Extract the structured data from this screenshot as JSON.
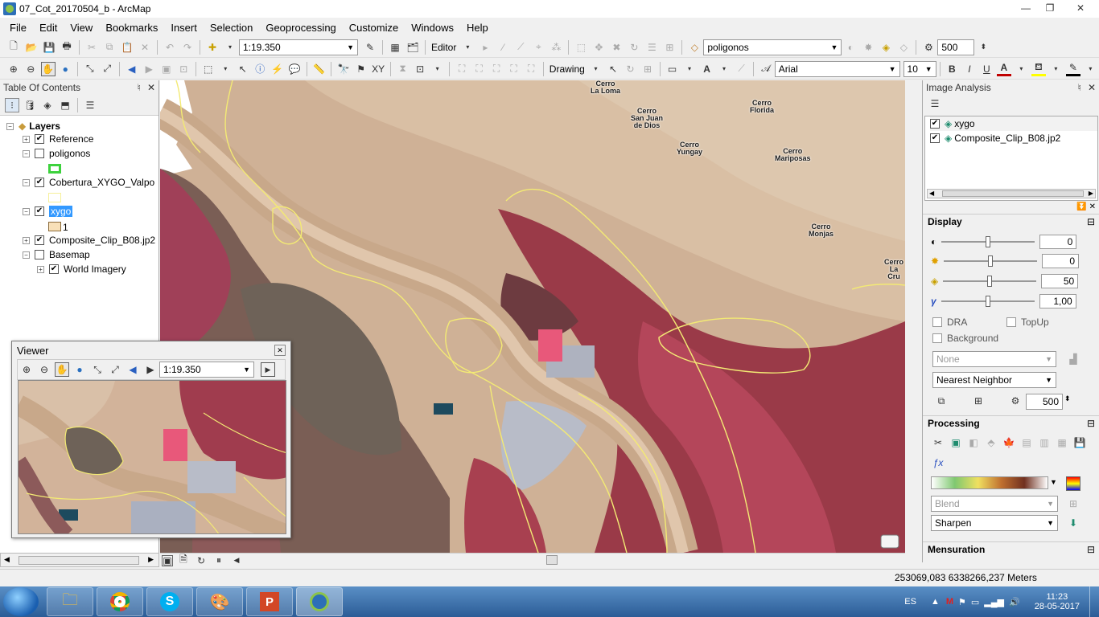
{
  "window": {
    "title": "07_Cot_20170504_b - ArcMap",
    "min": "—",
    "max": "❐",
    "close": "✕"
  },
  "menu": [
    "File",
    "Edit",
    "View",
    "Bookmarks",
    "Insert",
    "Selection",
    "Geoprocessing",
    "Customize",
    "Windows",
    "Help"
  ],
  "toolbar": {
    "scale": "1:19.350",
    "editor_label": "Editor",
    "layer_combo": "poligonos",
    "number_500": "500",
    "drawing_label": "Drawing",
    "font_name": "Arial",
    "font_size": "10",
    "bold": "B",
    "italic": "I",
    "underline": "U",
    "text_a": "A"
  },
  "toc": {
    "title": "Table Of Contents",
    "pin": "♮",
    "close": "✕",
    "layers_label": "Layers",
    "items": [
      {
        "label": "Reference",
        "checked": true
      },
      {
        "label": "poligonos",
        "checked": false
      },
      {
        "label": "Cobertura_XYGO_Valpo",
        "checked": true
      },
      {
        "label": "xygo",
        "checked": true
      },
      {
        "label": "Composite_Clip_B08.jp2",
        "checked": true
      },
      {
        "label": "Basemap",
        "checked": false
      },
      {
        "label": "World Imagery",
        "checked": true
      }
    ],
    "xygo_value": "1"
  },
  "map_labels": [
    {
      "text": "Cerro\nLa Loma"
    },
    {
      "text": "Cerro\nSan Juan\nde Dios"
    },
    {
      "text": "Cerro\nYungay"
    },
    {
      "text": "Cerro\nFlorida"
    },
    {
      "text": "Cerro\nMariposas"
    },
    {
      "text": "Cerro\nMonjas"
    },
    {
      "text": "Cerro\nLa Cru"
    }
  ],
  "viewer": {
    "title": "Viewer",
    "scale": "1:19.350",
    "close": "✕"
  },
  "image_analysis": {
    "title": "Image Analysis",
    "layers": [
      {
        "label": "xygo",
        "checked": true
      },
      {
        "label": "Composite_Clip_B08.jp2",
        "checked": true
      }
    ],
    "display_label": "Display",
    "sliders": [
      {
        "value": "0",
        "level": 0.5
      },
      {
        "value": "0",
        "level": 0.5
      },
      {
        "value": "50",
        "level": 0.5
      },
      {
        "value": "1,00",
        "level": 0.5
      }
    ],
    "dra_label": "DRA",
    "topup_label": "TopUp",
    "background_label": "Background",
    "none_option": "None",
    "resampling": "Nearest Neighbor",
    "resample_value": "500",
    "processing_label": "Processing",
    "blend_label": "Blend",
    "sharpen_label": "Sharpen",
    "mensuration_label": "Mensuration"
  },
  "status": {
    "coords": "253069,083  6338266,237 Meters"
  },
  "tray": {
    "lang": "ES",
    "time": "11:23",
    "date": "28-05-2017"
  }
}
